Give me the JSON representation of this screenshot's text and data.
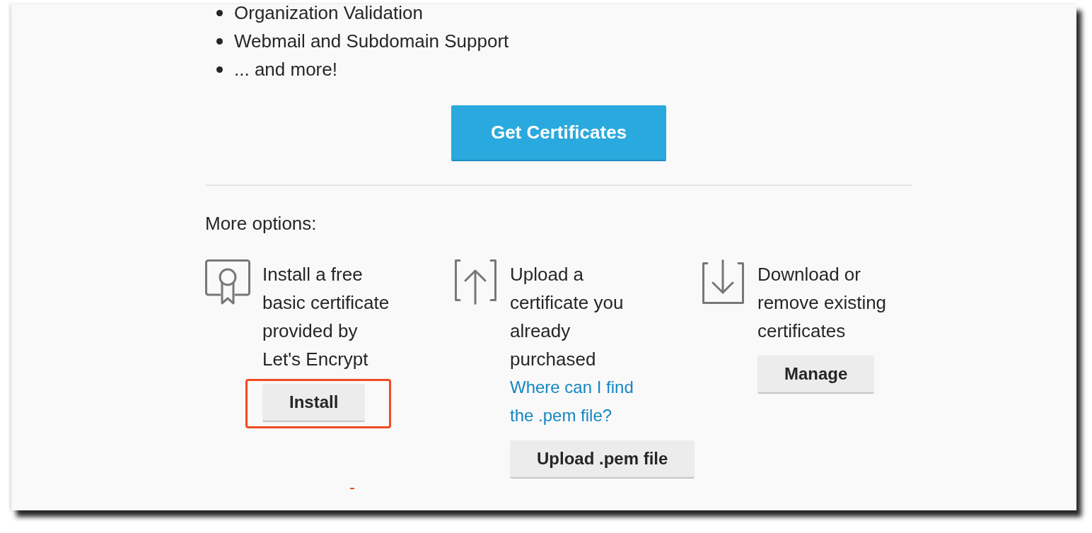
{
  "features": [
    "Organization Validation",
    "Webmail and Subdomain Support",
    "... and more!"
  ],
  "primary_button": {
    "label": "Get Certificates"
  },
  "more_options": {
    "heading": "More options:",
    "options": [
      {
        "kind": "certificate",
        "description": "Install a free basic certificate provided by Let's Encrypt",
        "button": "Install",
        "highlighted": true
      },
      {
        "kind": "upload",
        "description": "Upload a certificate you already purchased",
        "link": "Where can I find the .pem file?",
        "button": "Upload .pem file",
        "highlighted": false
      },
      {
        "kind": "download",
        "description": "Download or remove existing certificates",
        "button": "Manage",
        "highlighted": false
      }
    ]
  }
}
